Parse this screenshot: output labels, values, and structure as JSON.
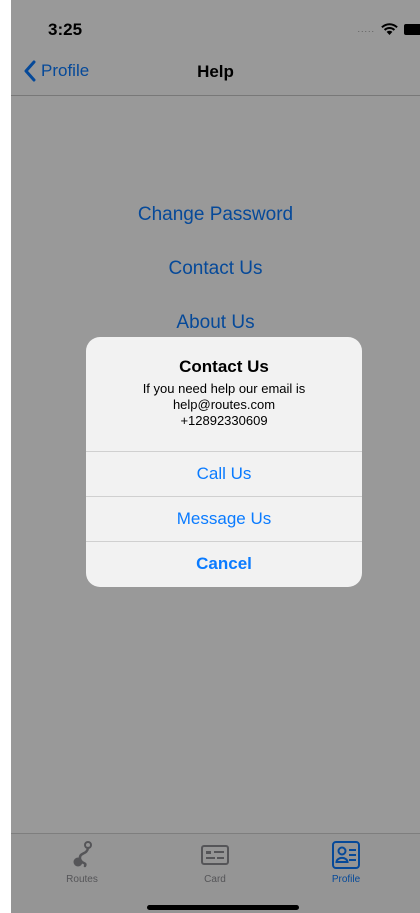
{
  "status_bar": {
    "time": "3:25",
    "signal": "....."
  },
  "nav": {
    "back_label": "Profile",
    "title": "Help"
  },
  "menu": {
    "items": [
      "Change Password",
      "Contact Us",
      "About Us"
    ]
  },
  "alert": {
    "title": "Contact Us",
    "message_lines": [
      "If you need help our email is",
      "help@routes.com",
      "+12892330609"
    ],
    "buttons": [
      "Call Us",
      "Message Us",
      "Cancel"
    ]
  },
  "tab_bar": {
    "tabs": [
      {
        "label": "Routes",
        "icon": "route-icon",
        "active": false
      },
      {
        "label": "Card",
        "icon": "card-icon",
        "active": false
      },
      {
        "label": "Profile",
        "icon": "profile-icon",
        "active": true
      }
    ]
  },
  "colors": {
    "accent": "#0a7bff",
    "overlay": "rgba(0,0,0,0.4)",
    "inactive_tab": "#8e8e93"
  }
}
